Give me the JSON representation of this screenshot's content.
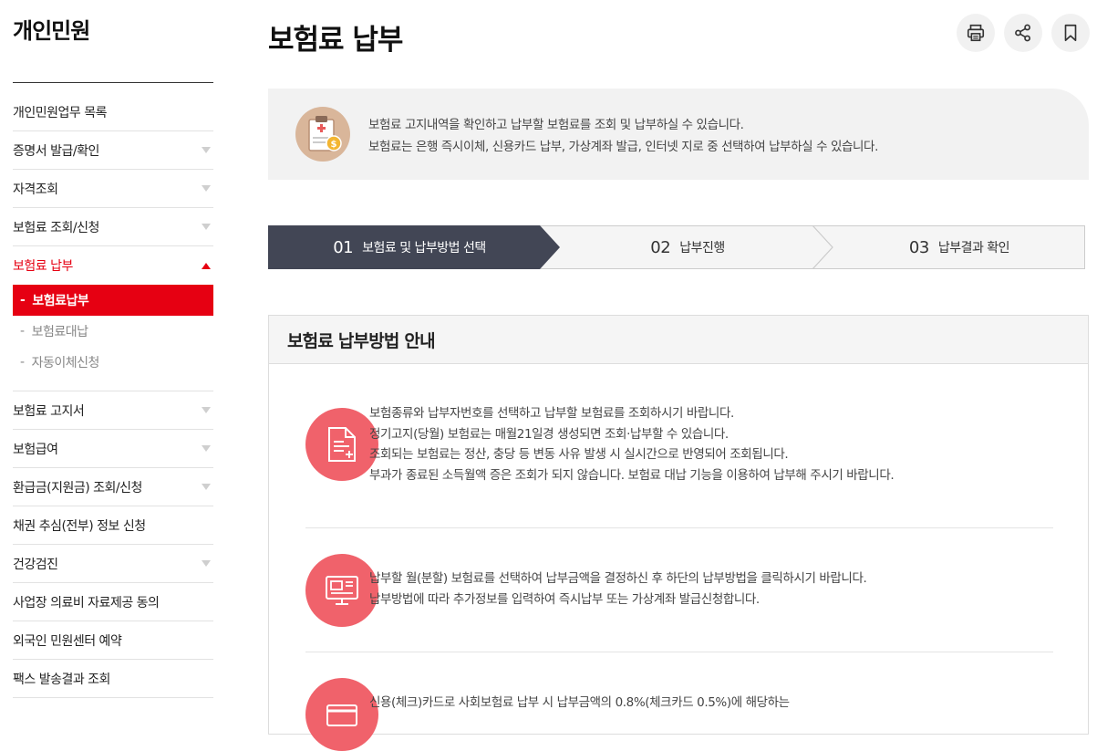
{
  "sidebar": {
    "title": "개인민원",
    "items": [
      {
        "label": "개인민원업무 목록",
        "arrow": false
      },
      {
        "label": "증명서 발급/확인",
        "arrow": true
      },
      {
        "label": "자격조회",
        "arrow": true
      },
      {
        "label": "보험료 조회/신청",
        "arrow": true
      },
      {
        "label": "보험료 납부",
        "arrow": true,
        "active": true
      },
      {
        "label": "보험료 고지서",
        "arrow": true
      },
      {
        "label": "보험급여",
        "arrow": true
      },
      {
        "label": "환급금(지원금) 조회/신청",
        "arrow": true
      },
      {
        "label": "채권 추심(전부) 정보 신청",
        "arrow": false
      },
      {
        "label": "건강검진",
        "arrow": true
      },
      {
        "label": "사업장 의료비 자료제공 동의",
        "arrow": false
      },
      {
        "label": "외국인 민원센터 예약",
        "arrow": false
      },
      {
        "label": "팩스 발송결과 조회",
        "arrow": false
      }
    ],
    "sub_items": [
      {
        "label": "보험료납부"
      },
      {
        "label": "보험료대납"
      },
      {
        "label": "자동이체신청"
      }
    ],
    "sub_dash": "-"
  },
  "header": {
    "title": "보험료 납부",
    "tools": [
      "print-icon",
      "share-icon",
      "bookmark-icon"
    ]
  },
  "info": {
    "line1": "보험료 고지내역을 확인하고 납부할 보험료를 조회 및 납부하실 수 있습니다.",
    "line2": "보험료는 은행 즉시이체, 신용카드 납부, 가상계좌 발급, 인터넷 지로 중 선택하여 납부하실 수 있습니다."
  },
  "steps": [
    {
      "num": "01",
      "label": "보험료 및 납부방법 선택",
      "active": true
    },
    {
      "num": "02",
      "label": "납부진행",
      "active": false
    },
    {
      "num": "03",
      "label": "납부결과 확인",
      "active": false
    }
  ],
  "guide": {
    "title": "보험료 납부방법 안내",
    "items": [
      {
        "icon": "document-icon",
        "lines": [
          "보험종류와 납부자번호를 선택하고 납부할 보험료를 조회하시기 바랍니다.",
          "정기고지(당월) 보험료는 매월21일경 생성되면 조회·납부할 수 있습니다.",
          "조회되는 보험료는 정산, 충당 등 변동 사유 발생 시 실시간으로 반영되어 조회됩니다.",
          "부과가 종료된 소득월액 증은 조회가 되지 않습니다. 보험료 대납 기능을 이용하여 납부해 주시기 바랍니다."
        ]
      },
      {
        "icon": "monitor-icon",
        "lines": [
          "납부할 월(분할) 보험료를 선택하여 납부금액을 결정하신 후 하단의 납부방법을 클릭하시기 바랍니다.",
          "납부방법에 따라 추가정보를 입력하여 즉시납부 또는 가상계좌 발급신청합니다."
        ]
      },
      {
        "icon": "card-icon",
        "lines": [
          "신용(체크)카드로 사회보험료 납부 시 납부금액의 0.8%(체크카드 0.5%)에 해당하는"
        ]
      }
    ]
  },
  "colors": {
    "accent": "#e60012",
    "step_active": "#424655",
    "icon_bg": "#f0626b"
  }
}
